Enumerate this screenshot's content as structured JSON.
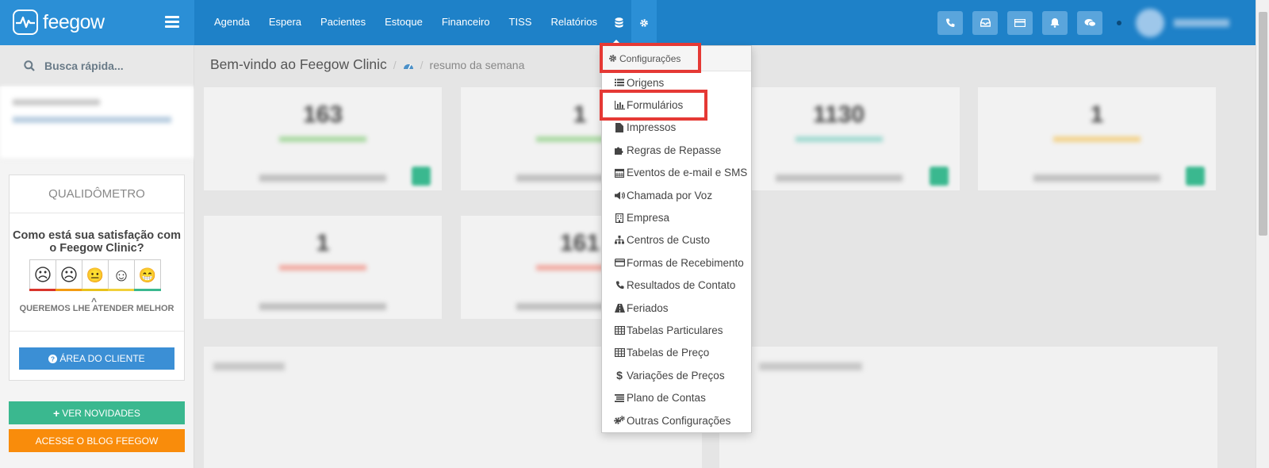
{
  "app": {
    "logo_text": "feegow"
  },
  "nav": {
    "items": [
      "Agenda",
      "Espera",
      "Pacientes",
      "Estoque",
      "Financeiro",
      "TISS",
      "Relatórios"
    ],
    "icons": [
      "database-icon",
      "gear-icon"
    ]
  },
  "topbar": {
    "buttons": [
      "phone-icon",
      "inbox-icon",
      "card-icon",
      "bell-icon",
      "chat-icon"
    ]
  },
  "sidebar": {
    "search_placeholder": "Busca rápida...",
    "quali_title": "QUALIDÔMETRO",
    "quali_question": "Como está sua satisfação com o Feegow Clinic?",
    "faces": [
      "☹",
      "☹",
      "😐",
      "☺",
      "😁"
    ],
    "face_colors": [
      "#d9342b",
      "#f39c12",
      "#e8c21c",
      "#f1d03a",
      "#3ab88f"
    ],
    "quali_sub": "QUEREMOS LHE ATENDER MELHOR",
    "area_btn": "ÁREA DO CLIENTE",
    "news_btn": "VER NOVIDADES",
    "blog_btn": "ACESSE O BLOG FEEGOW"
  },
  "main": {
    "title": "Bem-vindo ao Feegow Clinic",
    "subtitle": "resumo da semana"
  },
  "dropdown": {
    "header": "Configurações",
    "items": [
      {
        "icon": "list-icon",
        "label": "Origens"
      },
      {
        "icon": "bar-chart-icon",
        "label": "Formulários"
      },
      {
        "icon": "file-icon",
        "label": "Impressos"
      },
      {
        "icon": "puzzle-icon",
        "label": "Regras de Repasse"
      },
      {
        "icon": "calendar-icon",
        "label": "Eventos de e-mail e SMS"
      },
      {
        "icon": "volume-icon",
        "label": "Chamada por Voz"
      },
      {
        "icon": "building-icon",
        "label": "Empresa"
      },
      {
        "icon": "sitemap-icon",
        "label": "Centros de Custo"
      },
      {
        "icon": "credit-card-icon",
        "label": "Formas de Recebimento"
      },
      {
        "icon": "phone-icon",
        "label": "Resultados de Contato"
      },
      {
        "icon": "road-icon",
        "label": "Feriados"
      },
      {
        "icon": "table-icon",
        "label": "Tabelas Particulares"
      },
      {
        "icon": "table-icon",
        "label": "Tabelas de Preço"
      },
      {
        "icon": "dollar-icon",
        "label": "Variações de Preços"
      },
      {
        "icon": "list-alt-icon",
        "label": "Plano de Contas"
      },
      {
        "icon": "gears-icon",
        "label": "Outras Configurações"
      }
    ]
  }
}
